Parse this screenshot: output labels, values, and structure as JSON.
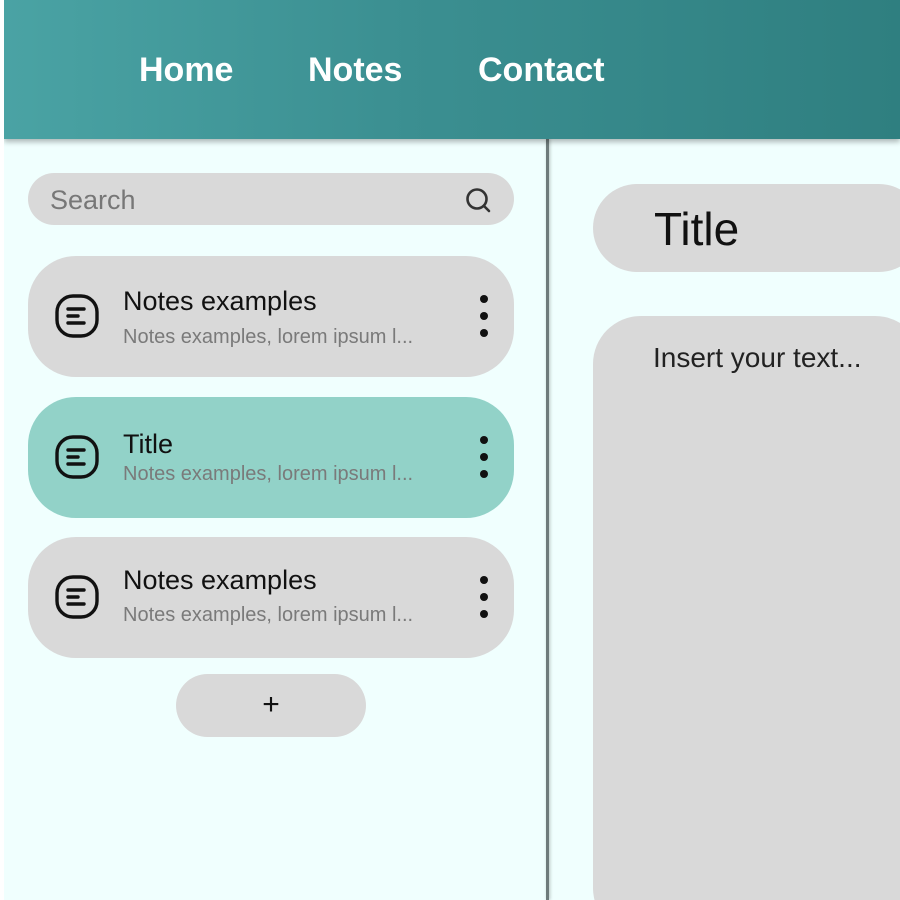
{
  "nav": {
    "items": [
      {
        "label": "Home"
      },
      {
        "label": "Notes"
      },
      {
        "label": "Contact"
      }
    ]
  },
  "search": {
    "placeholder": "Search",
    "icon": "search-icon"
  },
  "notes": [
    {
      "title": "Notes examples",
      "preview": "Notes examples, lorem ipsum l...",
      "icon": "note-icon",
      "active": false
    },
    {
      "title": "Title",
      "preview": "Notes examples, lorem ipsum l...",
      "icon": "note-icon",
      "active": true
    },
    {
      "title": "Notes examples",
      "preview": "Notes examples, lorem ipsum l...",
      "icon": "note-icon",
      "active": false
    }
  ],
  "add_button": {
    "label": "+"
  },
  "editor": {
    "title": "Title",
    "body_placeholder": "Insert your text..."
  },
  "colors": {
    "header_gradient_start": "#4aa3a4",
    "header_gradient_end": "#2f7f80",
    "background": "#f0fffe",
    "card": "#d9d9d9",
    "active_card": "#92d2c8"
  }
}
